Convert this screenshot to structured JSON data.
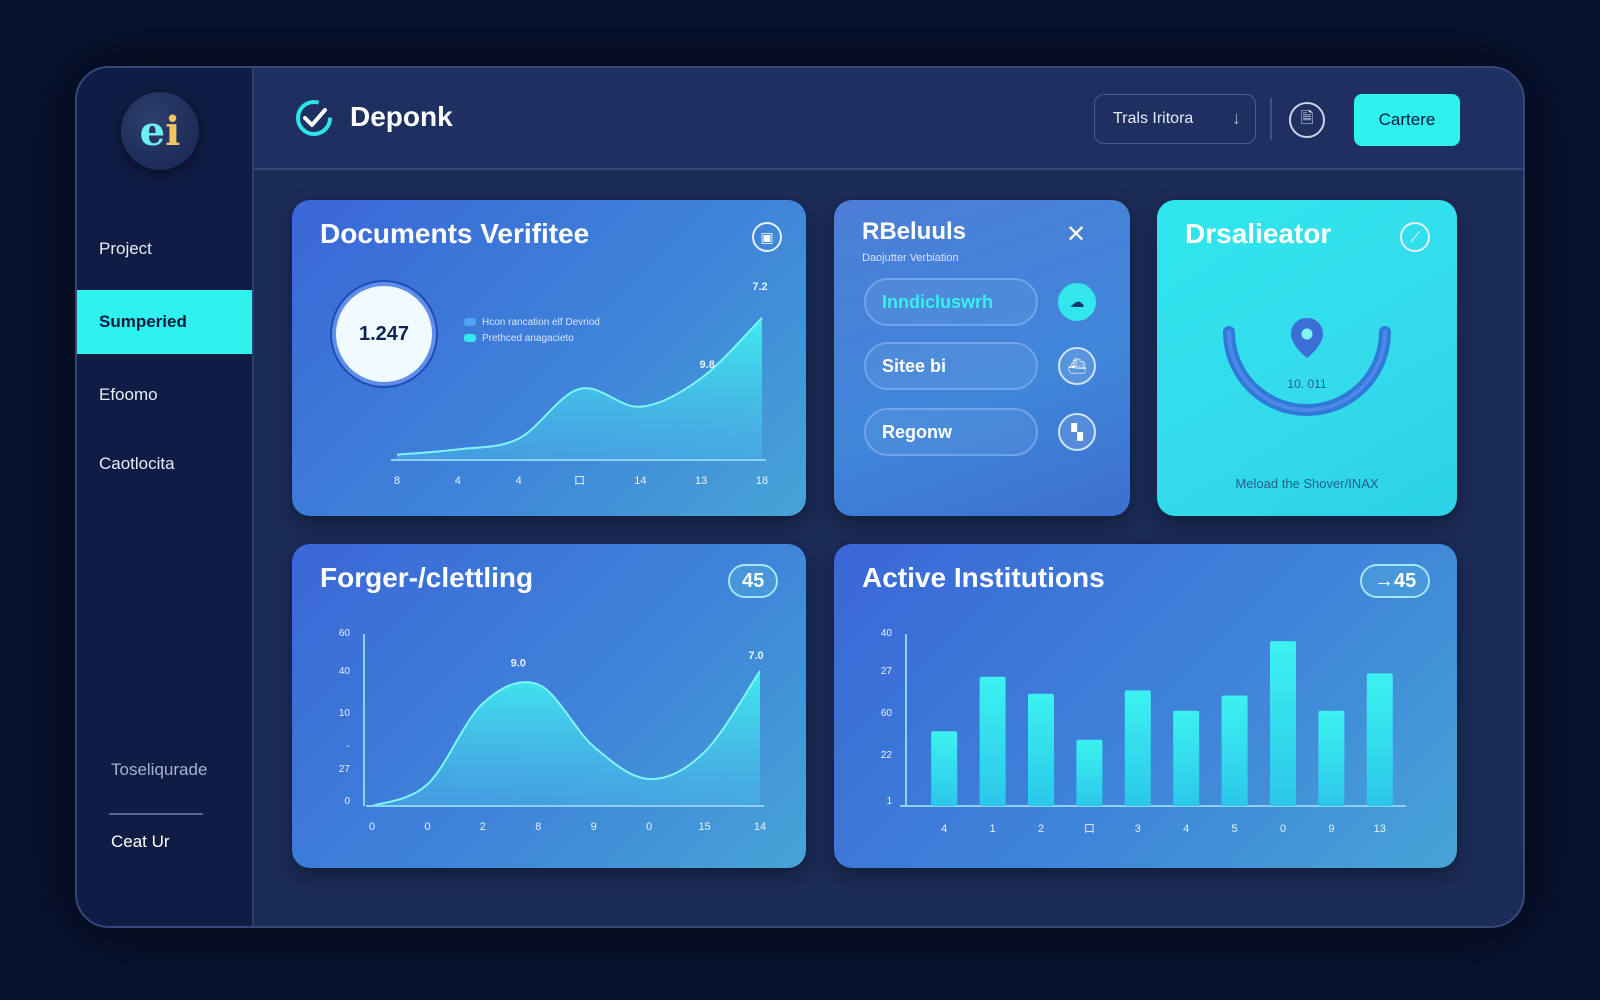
{
  "app": {
    "logo_text": "e",
    "logo_accent": "i"
  },
  "sidebar": {
    "items": [
      {
        "label": "Project",
        "active": false
      },
      {
        "label": "Sumperied",
        "active": true
      },
      {
        "label": "Efoomo",
        "active": false
      },
      {
        "label": "Caotlocita",
        "active": false
      }
    ],
    "footer_link_1": "Toseliqurade",
    "footer_link_2": "Ceat Ur"
  },
  "header": {
    "title": "Deponk",
    "select_value": "Trals Iritora",
    "select_chevron": "↓",
    "doc_icon": "🗎",
    "primary_button": "Cartere"
  },
  "colors": {
    "accent": "#2ef2ee",
    "sidebar_bg": "#0f1c44",
    "app_bg": "#1b2c57",
    "page_bg": "#07122e"
  },
  "cards": {
    "documents": {
      "title": "Documents Verifitee",
      "icon": "▣",
      "metric": "1.247",
      "legend": [
        "Hcon rancation elf Devriod",
        "Prethced anagacieto"
      ],
      "legend_colors": [
        "#4fa3f5",
        "#35e8ee"
      ]
    },
    "rbeluuls": {
      "title": "RBeluuls",
      "subtitle": "Daojutter Verbiation",
      "title_icon": "✕",
      "items": [
        {
          "label": "Inndicluswrh",
          "icon": "☁",
          "highlight": true
        },
        {
          "label": "Sitee bi",
          "icon": "⛴",
          "highlight": false
        },
        {
          "label": "Regonw",
          "icon": "▚",
          "highlight": false
        }
      ]
    },
    "drsalieator": {
      "title": "Drsalieator",
      "icon": "⟋",
      "gauge_value": "10. 011",
      "footer": "Meload the Shover/INAX"
    },
    "forger": {
      "title": "Forger-/clettling",
      "badge": "45"
    },
    "institutions": {
      "title": "Active Institutions",
      "badge": "→45"
    }
  },
  "chart_data": [
    {
      "type": "area",
      "name": "documents-verified",
      "x": [
        "8",
        "4",
        "4",
        "口",
        "14",
        "13",
        "18"
      ],
      "values": [
        3,
        6,
        12,
        40,
        30,
        46,
        80
      ],
      "annotations": [
        "9.8",
        "7.2"
      ],
      "ylim": [
        0,
        90
      ]
    },
    {
      "type": "area",
      "name": "forger-clettling",
      "x": [
        "0",
        "0",
        "2",
        "8",
        "9",
        "0",
        "15",
        "14"
      ],
      "y_ticks": [
        "60",
        "40",
        "10",
        "-",
        "27",
        "0"
      ],
      "values": [
        0,
        8,
        38,
        45,
        22,
        10,
        20,
        50
      ],
      "annotations": [
        "9.0",
        "7.0"
      ],
      "ylim": [
        0,
        60
      ]
    },
    {
      "type": "bar",
      "name": "active-institutions",
      "categories": [
        "4",
        "1",
        "2",
        "口",
        "3",
        "4",
        "5",
        "0",
        "9",
        "13"
      ],
      "y_ticks": [
        "40",
        "27",
        "60",
        "22",
        "1"
      ],
      "values": [
        44,
        76,
        66,
        39,
        68,
        56,
        65,
        97,
        56,
        78
      ],
      "ylim": [
        0,
        100
      ]
    }
  ]
}
